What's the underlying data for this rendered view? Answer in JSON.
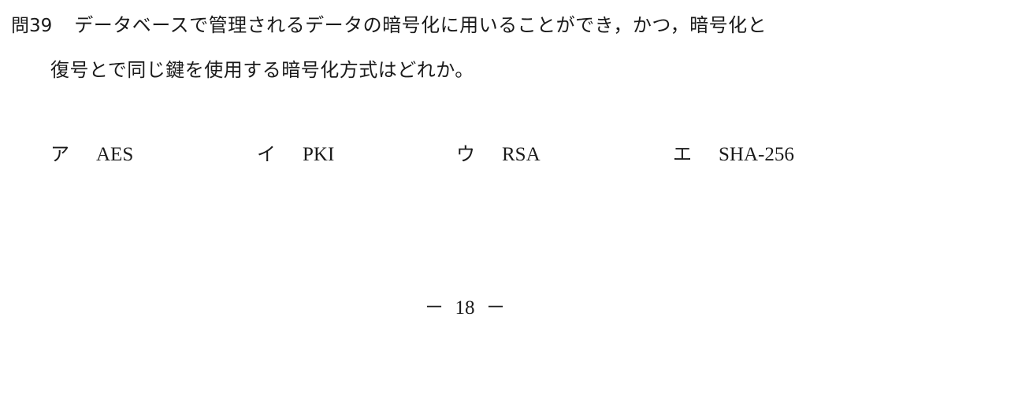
{
  "question": {
    "number": "問39",
    "line1": "データベースで管理されるデータの暗号化に用いることができ，かつ，暗号化と",
    "line2": "復号とで同じ鍵を使用する暗号化方式はどれか。"
  },
  "choices": [
    {
      "label": "ア",
      "text": "AES"
    },
    {
      "label": "イ",
      "text": "PKI"
    },
    {
      "label": "ウ",
      "text": "RSA"
    },
    {
      "label": "エ",
      "text": "SHA-256"
    }
  ],
  "footer": {
    "dash_left": "－",
    "page_number": "18",
    "dash_right": "－"
  }
}
